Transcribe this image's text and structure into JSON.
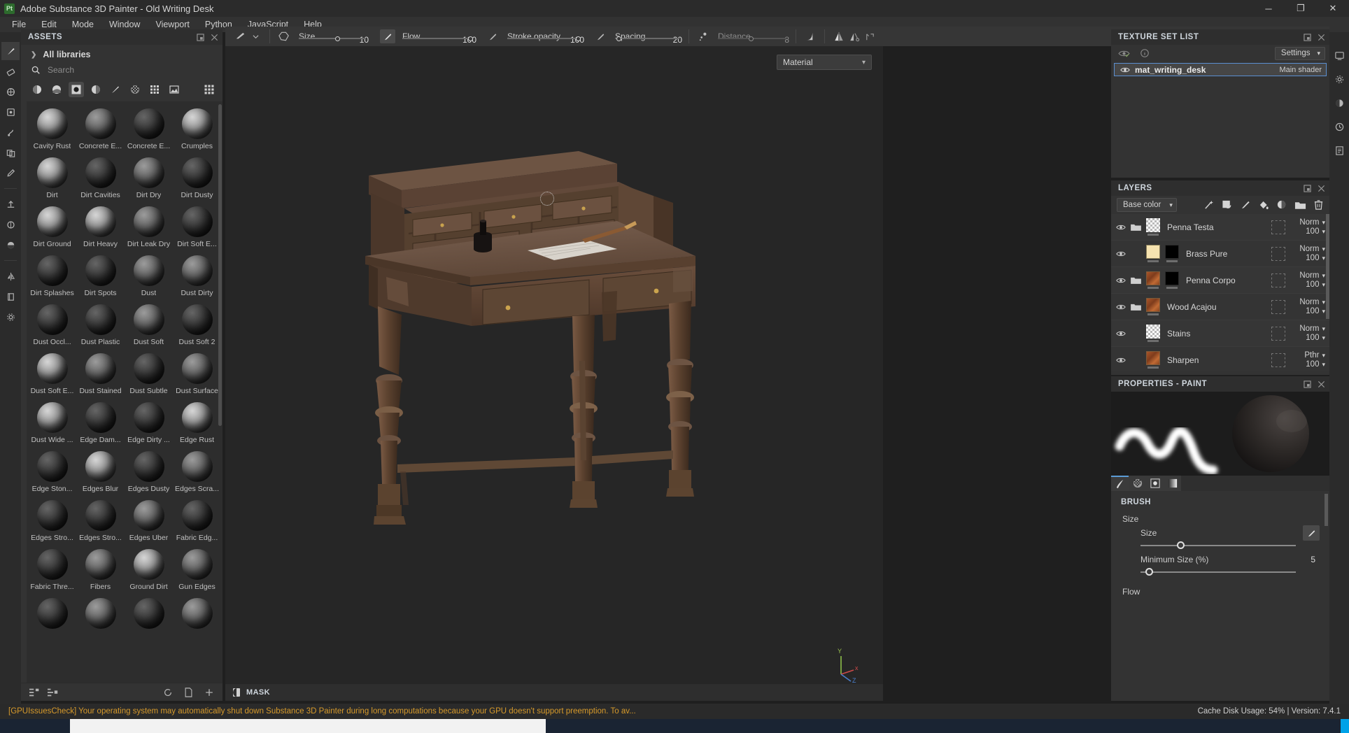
{
  "titlebar": {
    "logo": "Pt",
    "title": "Adobe Substance 3D Painter - Old Writing Desk",
    "minimize": "─",
    "maximize": "❐",
    "close": "✕"
  },
  "menubar": {
    "items": [
      "File",
      "Edit",
      "Mode",
      "Window",
      "Viewport",
      "Python",
      "JavaScript",
      "Help"
    ]
  },
  "toolbar": {
    "size_label": "Size",
    "size_value": "10",
    "flow_label": "Flow",
    "flow_value": "100",
    "stroke_opacity_label": "Stroke opacity",
    "stroke_opacity_value": "100",
    "spacing_label": "Spacing",
    "spacing_value": "20",
    "distance_label": "Distance",
    "distance_value": "8"
  },
  "assets": {
    "panel_title": "ASSETS",
    "library_label": "All libraries",
    "search_placeholder": "Search",
    "filters": [
      "sphere-full-icon",
      "sphere-half-icon",
      "sphere-mask-icon",
      "sphere-gradient-icon",
      "brush-icon",
      "checker-icon",
      "grid-icon",
      "image-icon"
    ],
    "active_filter_index": 2,
    "grid_view_icon": "grid-view-icon",
    "items": [
      {
        "label": "Cavity Rust",
        "tone": "light"
      },
      {
        "label": "Concrete E...",
        "tone": "mid"
      },
      {
        "label": "Concrete E...",
        "tone": "dark"
      },
      {
        "label": "Crumples",
        "tone": "light"
      },
      {
        "label": "Dirt",
        "tone": "light"
      },
      {
        "label": "Dirt Cavities",
        "tone": "dark"
      },
      {
        "label": "Dirt Dry",
        "tone": "mid"
      },
      {
        "label": "Dirt Dusty",
        "tone": "dark"
      },
      {
        "label": "Dirt Ground",
        "tone": "light"
      },
      {
        "label": "Dirt Heavy",
        "tone": "light"
      },
      {
        "label": "Dirt Leak Dry",
        "tone": "mid"
      },
      {
        "label": "Dirt Soft E...",
        "tone": "dark"
      },
      {
        "label": "Dirt Splashes",
        "tone": "dark"
      },
      {
        "label": "Dirt Spots",
        "tone": "dark"
      },
      {
        "label": "Dust",
        "tone": "mid"
      },
      {
        "label": "Dust Dirty",
        "tone": "mid"
      },
      {
        "label": "Dust Occl...",
        "tone": "dark"
      },
      {
        "label": "Dust Plastic",
        "tone": "dark"
      },
      {
        "label": "Dust Soft",
        "tone": "mid"
      },
      {
        "label": "Dust Soft 2",
        "tone": "dark"
      },
      {
        "label": "Dust Soft E...",
        "tone": "light"
      },
      {
        "label": "Dust Stained",
        "tone": "mid"
      },
      {
        "label": "Dust Subtle",
        "tone": "dark"
      },
      {
        "label": "Dust Surface",
        "tone": "mid"
      },
      {
        "label": "Dust Wide ...",
        "tone": "light"
      },
      {
        "label": "Edge Dam...",
        "tone": "dark"
      },
      {
        "label": "Edge Dirty ...",
        "tone": "dark"
      },
      {
        "label": "Edge Rust",
        "tone": "light"
      },
      {
        "label": "Edge Ston...",
        "tone": "dark"
      },
      {
        "label": "Edges Blur",
        "tone": "light"
      },
      {
        "label": "Edges Dusty",
        "tone": "dark"
      },
      {
        "label": "Edges Scra...",
        "tone": "mid"
      },
      {
        "label": "Edges Stro...",
        "tone": "dark"
      },
      {
        "label": "Edges Stro...",
        "tone": "dark"
      },
      {
        "label": "Edges Uber",
        "tone": "mid"
      },
      {
        "label": "Fabric Edg...",
        "tone": "dark"
      },
      {
        "label": "Fabric Thre...",
        "tone": "dark"
      },
      {
        "label": "Fibers",
        "tone": "mid"
      },
      {
        "label": "Ground Dirt",
        "tone": "light"
      },
      {
        "label": "Gun Edges",
        "tone": "mid"
      },
      {
        "label": "",
        "tone": "dark"
      },
      {
        "label": "",
        "tone": "mid"
      },
      {
        "label": "",
        "tone": "dark"
      },
      {
        "label": "",
        "tone": "mid"
      }
    ]
  },
  "viewport": {
    "material_dropdown": "Material",
    "mask_label": "MASK",
    "axis_x": "x",
    "axis_y": "Y",
    "axis_z": "Z"
  },
  "texture_set_list": {
    "panel_title": "TEXTURE SET LIST",
    "settings_label": "Settings",
    "items": [
      {
        "name": "mat_writing_desk",
        "shader": "Main shader",
        "selected": true
      }
    ]
  },
  "layers": {
    "panel_title": "LAYERS",
    "channel_select": "Base color",
    "toolbar_icons": [
      "magic-wand-icon",
      "add-fill-layer-icon",
      "add-paint-layer-icon",
      "add-fill-icon",
      "add-adjustment-icon",
      "add-folder-icon",
      "delete-layer-icon"
    ],
    "rows": [
      {
        "name": "Penna Testa",
        "blend": "Norm",
        "opacity": "100",
        "folder": true,
        "thumbs": [
          "checker"
        ]
      },
      {
        "name": "Brass Pure",
        "blend": "Norm",
        "opacity": "100",
        "folder": false,
        "thumbs": [
          "cream",
          "black"
        ]
      },
      {
        "name": "Penna Corpo",
        "blend": "Norm",
        "opacity": "100",
        "folder": true,
        "thumbs": [
          "wood",
          "black"
        ]
      },
      {
        "name": "Wood Acajou",
        "blend": "Norm",
        "opacity": "100",
        "folder": true,
        "thumbs": [
          "wood"
        ]
      },
      {
        "name": "Stains",
        "blend": "Norm",
        "opacity": "100",
        "folder": false,
        "thumbs": [
          "checker"
        ]
      },
      {
        "name": "Sharpen",
        "blend": "Pthr",
        "opacity": "100",
        "folder": false,
        "thumbs": [
          "wood"
        ]
      }
    ]
  },
  "properties": {
    "panel_title": "PROPERTIES - PAINT",
    "tabs": [
      "material-tab",
      "grayscale-tab",
      "alpha-tab",
      "gradient-tab"
    ],
    "active_tab_index": 0,
    "section_title": "BRUSH",
    "groups": [
      {
        "label": "Size",
        "params": [
          {
            "name": "Size",
            "value": "10",
            "fill": 0.3,
            "pen": true
          },
          {
            "name": "Minimum Size (%)",
            "value": "5",
            "fill": 0.05,
            "pen": false
          }
        ]
      },
      {
        "label": "Flow",
        "params": []
      }
    ]
  },
  "statusbar": {
    "message": "[GPUIssuesCheck] Your operating system may automatically shut down Substance 3D Painter during long computations because your GPU doesn't support preemption. To av...",
    "cache_label": "Cache Disk Usage:",
    "cache_value": "54%",
    "separator": "|",
    "version_label": "Version:",
    "version_value": "7.4.1"
  },
  "colors": {
    "accent_blue": "#5b8fd0",
    "warning": "#d79a2b",
    "panel_bg": "#333333",
    "wood": "#6b4a33"
  }
}
